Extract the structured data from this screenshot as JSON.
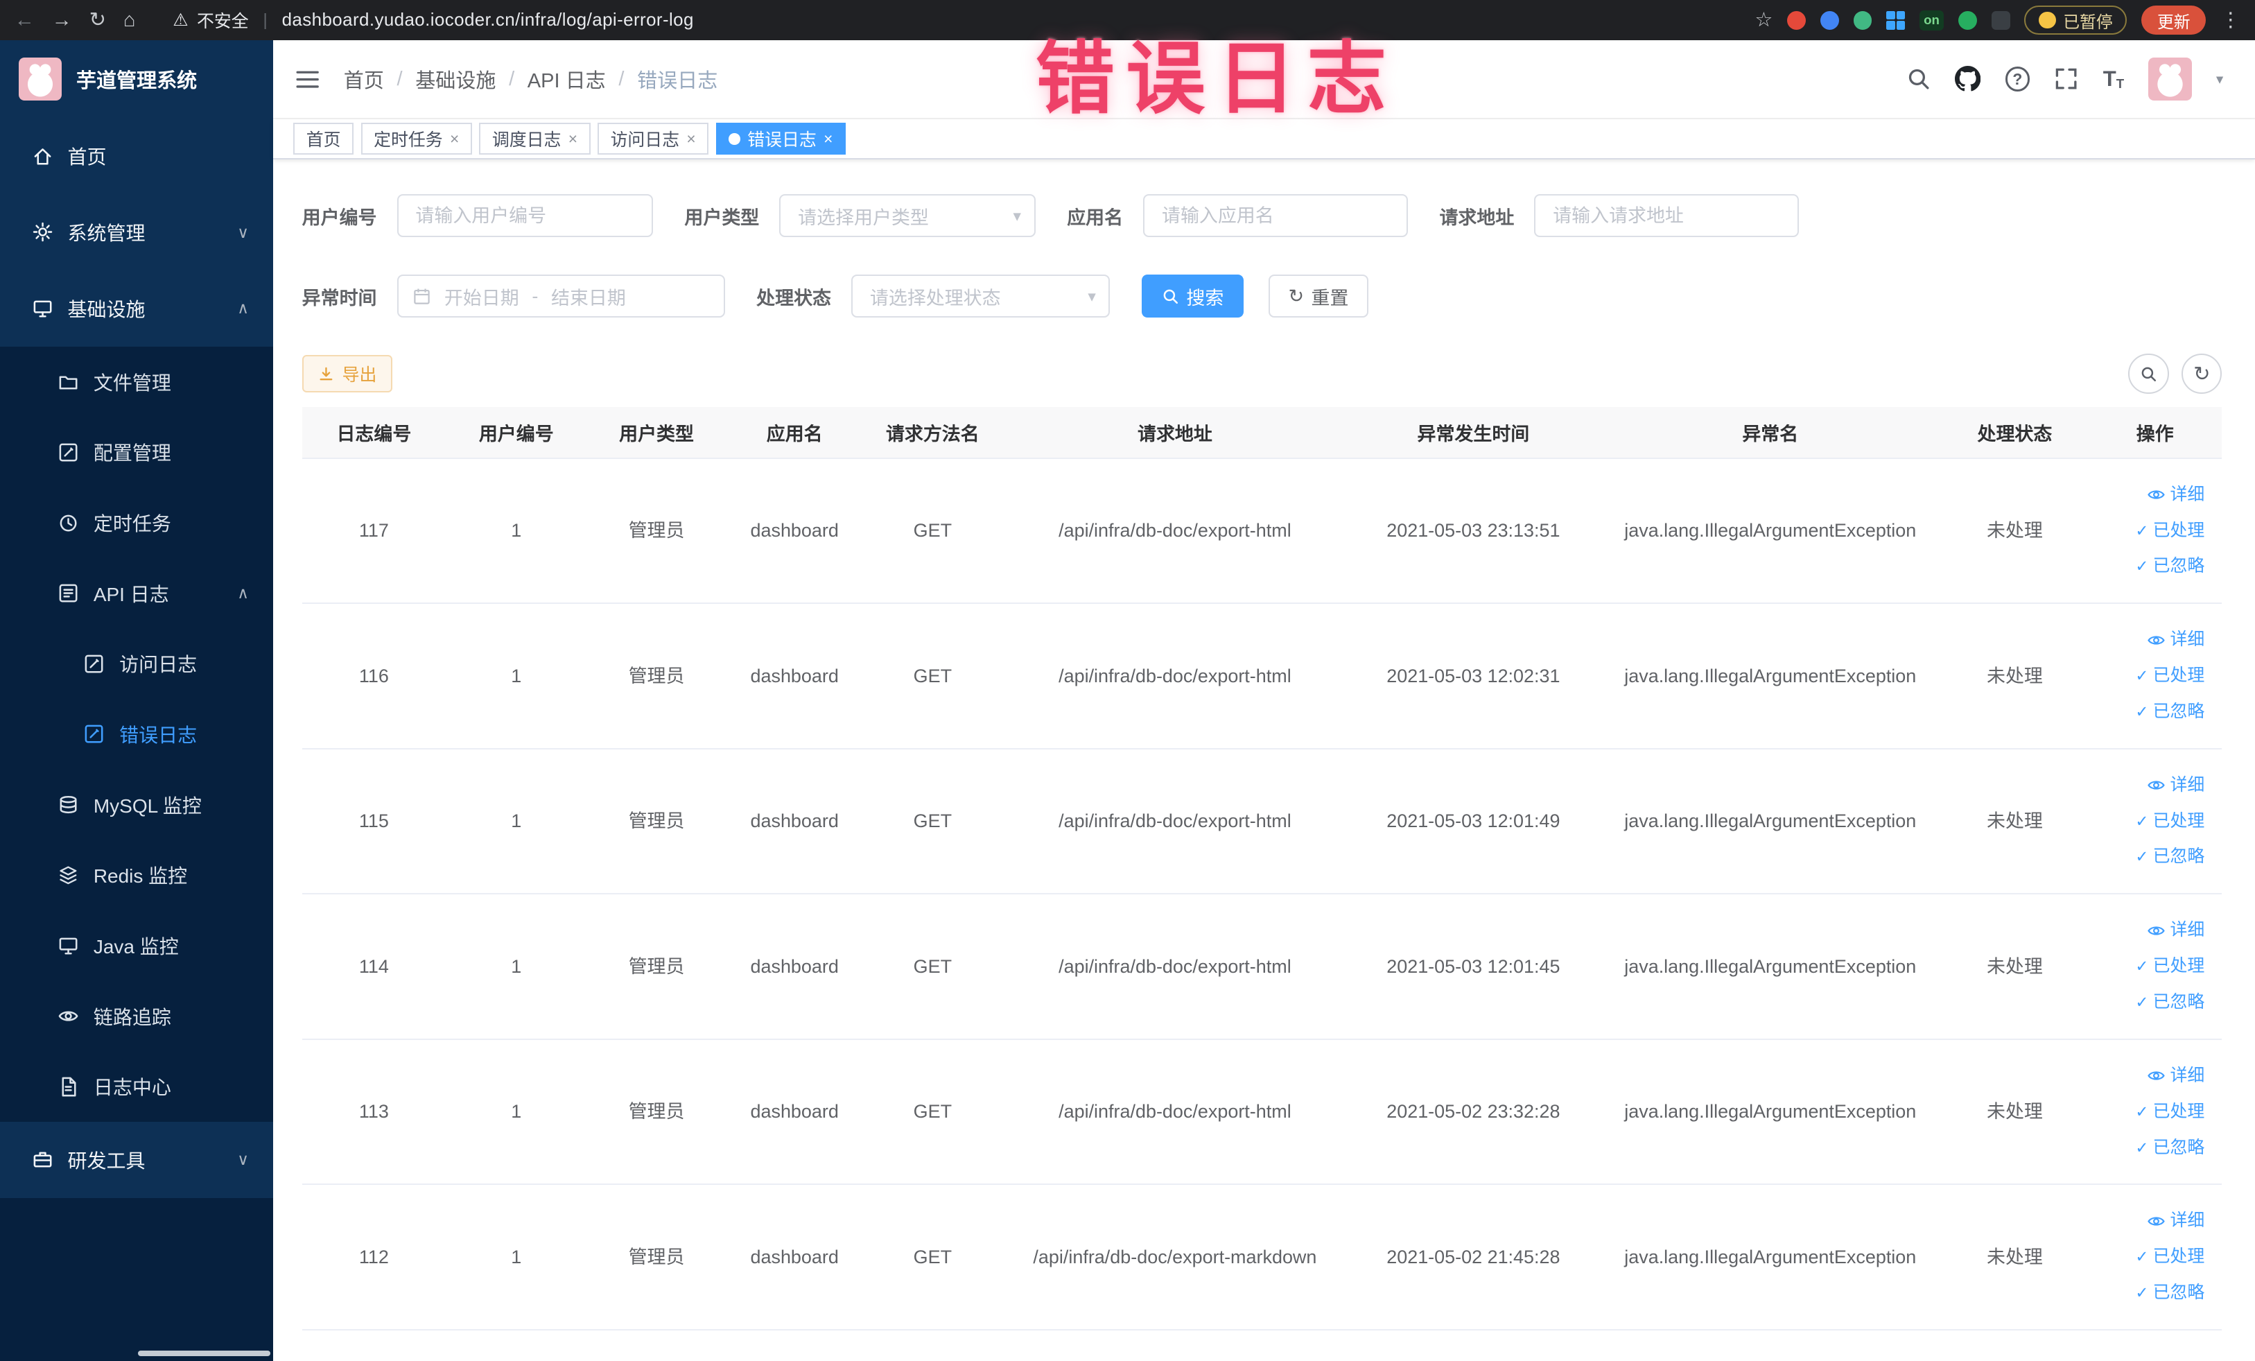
{
  "browser": {
    "security_label": "不安全",
    "url": "dashboard.yudao.iocoder.cn/infra/log/api-error-log",
    "paused_badge": "已暂停",
    "update_label": "更新"
  },
  "sidebar": {
    "logo_title": "芋道管理系统",
    "items": [
      {
        "label": "首页"
      },
      {
        "label": "系统管理"
      },
      {
        "label": "基础设施"
      },
      {
        "label": "文件管理"
      },
      {
        "label": "配置管理"
      },
      {
        "label": "定时任务"
      },
      {
        "label": "API 日志"
      },
      {
        "label": "访问日志"
      },
      {
        "label": "错误日志"
      },
      {
        "label": "MySQL 监控"
      },
      {
        "label": "Redis 监控"
      },
      {
        "label": "Java 监控"
      },
      {
        "label": "链路追踪"
      },
      {
        "label": "日志中心"
      },
      {
        "label": "研发工具"
      }
    ]
  },
  "breadcrumb": {
    "items": [
      "首页",
      "基础设施",
      "API 日志",
      "错误日志"
    ]
  },
  "annotation": "错误日志",
  "tabs": [
    {
      "label": "首页"
    },
    {
      "label": "定时任务"
    },
    {
      "label": "调度日志"
    },
    {
      "label": "访问日志"
    },
    {
      "label": "错误日志"
    }
  ],
  "filters": {
    "user_id": {
      "label": "用户编号",
      "placeholder": "请输入用户编号"
    },
    "user_type": {
      "label": "用户类型",
      "placeholder": "请选择用户类型"
    },
    "app_name": {
      "label": "应用名",
      "placeholder": "请输入应用名"
    },
    "request_url": {
      "label": "请求地址",
      "placeholder": "请输入请求地址"
    },
    "exception_time": {
      "label": "异常时间",
      "start_placeholder": "开始日期",
      "separator": "-",
      "end_placeholder": "结束日期"
    },
    "process_status": {
      "label": "处理状态",
      "placeholder": "请选择处理状态"
    },
    "search_label": "搜索",
    "reset_label": "重置"
  },
  "toolbar": {
    "export_label": "导出"
  },
  "table": {
    "columns": [
      "日志编号",
      "用户编号",
      "用户类型",
      "应用名",
      "请求方法名",
      "请求地址",
      "异常发生时间",
      "异常名",
      "处理状态",
      "操作"
    ],
    "rows": [
      {
        "log_id": "117",
        "user_id": "1",
        "user_type": "管理员",
        "app_name": "dashboard",
        "method": "GET",
        "url": "/api/infra/db-doc/export-html",
        "time": "2021-05-03 23:13:51",
        "exception": "java.lang.IllegalArgumentException",
        "status": "未处理"
      },
      {
        "log_id": "116",
        "user_id": "1",
        "user_type": "管理员",
        "app_name": "dashboard",
        "method": "GET",
        "url": "/api/infra/db-doc/export-html",
        "time": "2021-05-03 12:02:31",
        "exception": "java.lang.IllegalArgumentException",
        "status": "未处理"
      },
      {
        "log_id": "115",
        "user_id": "1",
        "user_type": "管理员",
        "app_name": "dashboard",
        "method": "GET",
        "url": "/api/infra/db-doc/export-html",
        "time": "2021-05-03 12:01:49",
        "exception": "java.lang.IllegalArgumentException",
        "status": "未处理"
      },
      {
        "log_id": "114",
        "user_id": "1",
        "user_type": "管理员",
        "app_name": "dashboard",
        "method": "GET",
        "url": "/api/infra/db-doc/export-html",
        "time": "2021-05-03 12:01:45",
        "exception": "java.lang.IllegalArgumentException",
        "status": "未处理"
      },
      {
        "log_id": "113",
        "user_id": "1",
        "user_type": "管理员",
        "app_name": "dashboard",
        "method": "GET",
        "url": "/api/infra/db-doc/export-html",
        "time": "2021-05-02 23:32:28",
        "exception": "java.lang.IllegalArgumentException",
        "status": "未处理"
      },
      {
        "log_id": "112",
        "user_id": "1",
        "user_type": "管理员",
        "app_name": "dashboard",
        "method": "GET",
        "url": "/api/infra/db-doc/export-markdown",
        "time": "2021-05-02 21:45:28",
        "exception": "java.lang.IllegalArgumentException",
        "status": "未处理"
      }
    ]
  },
  "actions": {
    "detail": "详细",
    "processed": "已处理",
    "ignored": "已忽略"
  },
  "icons": {
    "back": "←",
    "forward": "→",
    "reload": "↻",
    "home": "⌂",
    "warning": "⚠",
    "divider": "|",
    "star": "☆",
    "kebab": "⋮",
    "separator": "/",
    "help": "?",
    "font_size": "T",
    "caret_down": "▾",
    "chevron_down": "∨",
    "chevron_up": "∧",
    "close": "×",
    "check": "✓",
    "ext_on": "on"
  },
  "colors": {
    "accent": "#409eff",
    "warning": "#e6a23c",
    "annotation": "#ee4168",
    "sidebar": "#06203e",
    "sidebar_row": "#0d3055"
  }
}
